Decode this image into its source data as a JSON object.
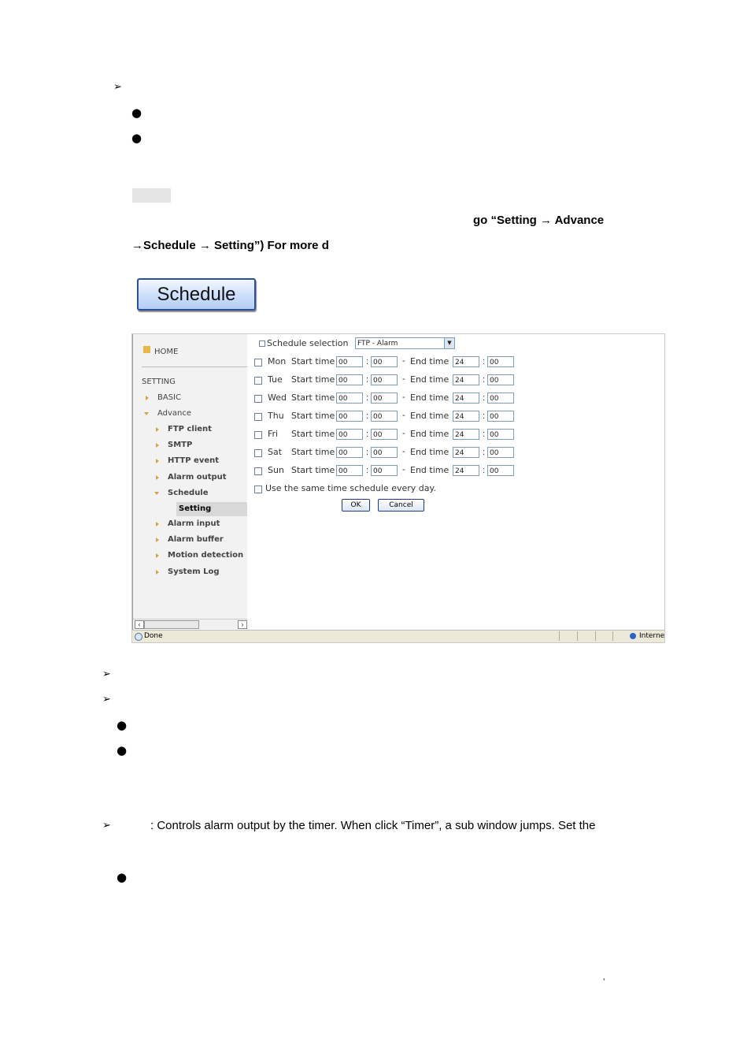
{
  "doc": {
    "line1_text": "go “Setting → Advance",
    "line2_text": "→Schedule → Setting”) For more d",
    "schedule_button_label": "Schedule",
    "timer_text": ": Controls alarm output by the timer. When click “Timer”, a sub window jumps. Set the",
    "footer_mark": "’"
  },
  "screenshot": {
    "sidebar": {
      "home": "HOME",
      "setting": "SETTING",
      "items": [
        "BASIC",
        "Advance",
        "FTP client",
        "SMTP",
        "HTTP event",
        "Alarm output",
        "Schedule",
        "Setting",
        "Alarm input",
        "Alarm buffer",
        "Motion detection",
        "System Log"
      ]
    },
    "schedule_selection_label": "Schedule selection",
    "schedule_selection_value": "FTP - Alarm",
    "start_label": "Start time",
    "end_label": "End time",
    "days": [
      {
        "day": "Mon",
        "sh": "00",
        "sm": "00",
        "eh": "24",
        "em": "00"
      },
      {
        "day": "Tue",
        "sh": "00",
        "sm": "00",
        "eh": "24",
        "em": "00"
      },
      {
        "day": "Wed",
        "sh": "00",
        "sm": "00",
        "eh": "24",
        "em": "00"
      },
      {
        "day": "Thu",
        "sh": "00",
        "sm": "00",
        "eh": "24",
        "em": "00"
      },
      {
        "day": "Fri",
        "sh": "00",
        "sm": "00",
        "eh": "24",
        "em": "00"
      },
      {
        "day": "Sat",
        "sh": "00",
        "sm": "00",
        "eh": "24",
        "em": "00"
      },
      {
        "day": "Sun",
        "sh": "00",
        "sm": "00",
        "eh": "24",
        "em": "00"
      }
    ],
    "same_schedule_label": "Use the same time schedule every day.",
    "ok_label": "OK",
    "cancel_label": "Cancel",
    "status_done": "Done",
    "status_zone": "Internet"
  }
}
